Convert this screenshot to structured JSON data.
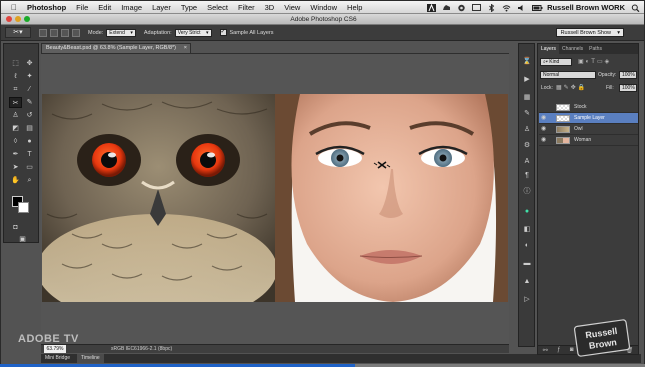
{
  "menubar": {
    "apple_icon": "apple-icon",
    "app_name": "Photoshop",
    "items": [
      "File",
      "Edit",
      "Image",
      "Layer",
      "Type",
      "Select",
      "Filter",
      "3D",
      "View",
      "Window",
      "Help"
    ],
    "user": "Russell Brown WORK"
  },
  "window": {
    "title": "Adobe Photoshop CS6"
  },
  "options": {
    "tool_icon": "content-aware-move-icon",
    "mode_label": "Mode:",
    "mode_value": "Extend",
    "adaptation_label": "Adaptation:",
    "adaptation_value": "Very Strict",
    "sample_all_label": "Sample All Layers",
    "sample_all_checked": true,
    "workspace": "Russell Brown Show"
  },
  "document": {
    "tab_title": "Beauty&Beast.psd @ 63.8% (Sample Layer, RGB/8*)",
    "zoom": "63.79%",
    "status_info": "sRGB IEC61966-2.1 (8bpc)"
  },
  "panels": {
    "tabs": [
      "Layers",
      "Channels",
      "Paths"
    ],
    "kind_label": "Kind",
    "blend_mode": "Normal",
    "opacity_label": "Opacity:",
    "opacity": "100%",
    "lock_label": "Lock:",
    "fill_label": "Fill:",
    "fill": "100%",
    "layers": [
      {
        "name": "Stock",
        "visible": false,
        "selected": false
      },
      {
        "name": "Sample Layer",
        "visible": true,
        "selected": true
      },
      {
        "name": "Owl",
        "visible": true,
        "selected": false
      },
      {
        "name": "Woman",
        "visible": true,
        "selected": false
      }
    ]
  },
  "bottom": {
    "tabs": [
      "Mini Bridge",
      "Timeline"
    ]
  },
  "overlay": {
    "adobe_tv": "ADOBE TV",
    "logo_line1": "Russell",
    "logo_line2": "Brown"
  },
  "video": {
    "progress": 0.55
  },
  "colors": {
    "accent": "#1f62c7",
    "layer_selected": "#5a7fc0",
    "owl_eye": "#e8380f"
  }
}
